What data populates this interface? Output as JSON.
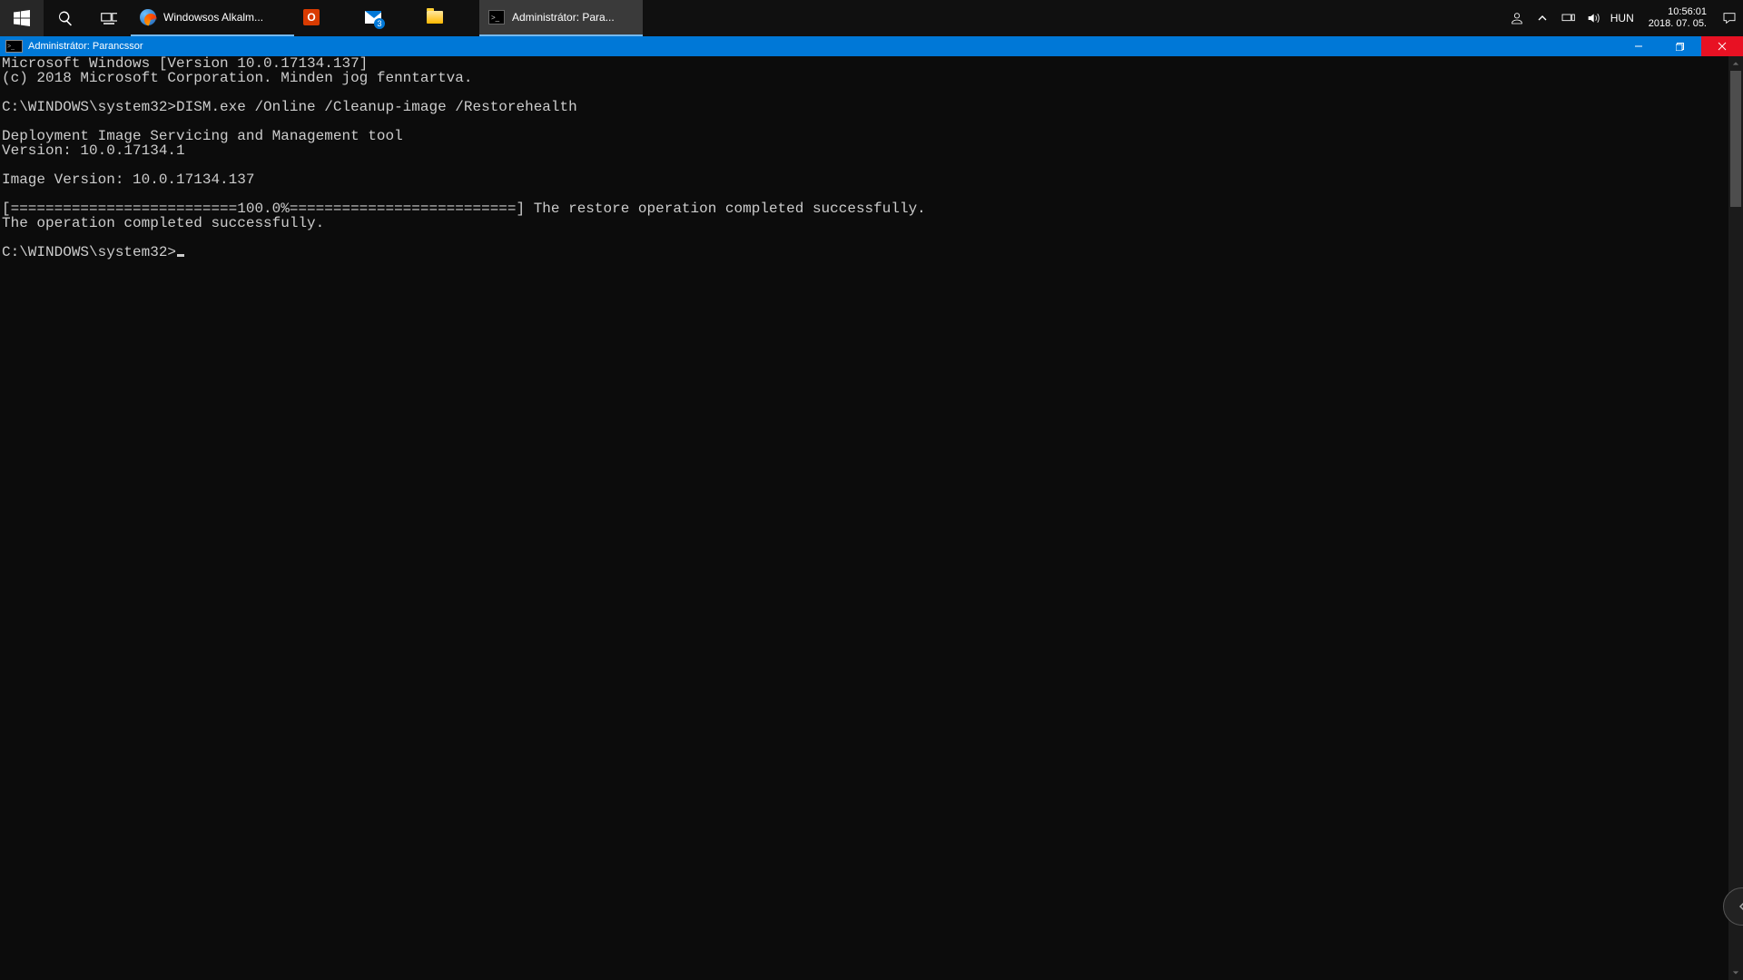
{
  "taskbar": {
    "firefox_label": "Windowsos Alkalm...",
    "office_letter": "O",
    "mail_badge": "3",
    "cmd_label": "Administrátor: Para...",
    "lang": "HUN",
    "time": "10:56:01",
    "date": "2018. 07. 05."
  },
  "window": {
    "title": "Administrátor: Parancssor"
  },
  "terminal": {
    "line1": "Microsoft Windows [Version 10.0.17134.137]",
    "line2": "(c) 2018 Microsoft Corporation. Minden jog fenntartva.",
    "blank1": "",
    "line3": "C:\\WINDOWS\\system32>DISM.exe /Online /Cleanup-image /Restorehealth",
    "blank2": "",
    "line4": "Deployment Image Servicing and Management tool",
    "line5": "Version: 10.0.17134.1",
    "blank3": "",
    "line6": "Image Version: 10.0.17134.137",
    "blank4": "",
    "line7": "[==========================100.0%==========================] The restore operation completed successfully.",
    "line8": "The operation completed successfully.",
    "blank5": "",
    "prompt": "C:\\WINDOWS\\system32>"
  }
}
